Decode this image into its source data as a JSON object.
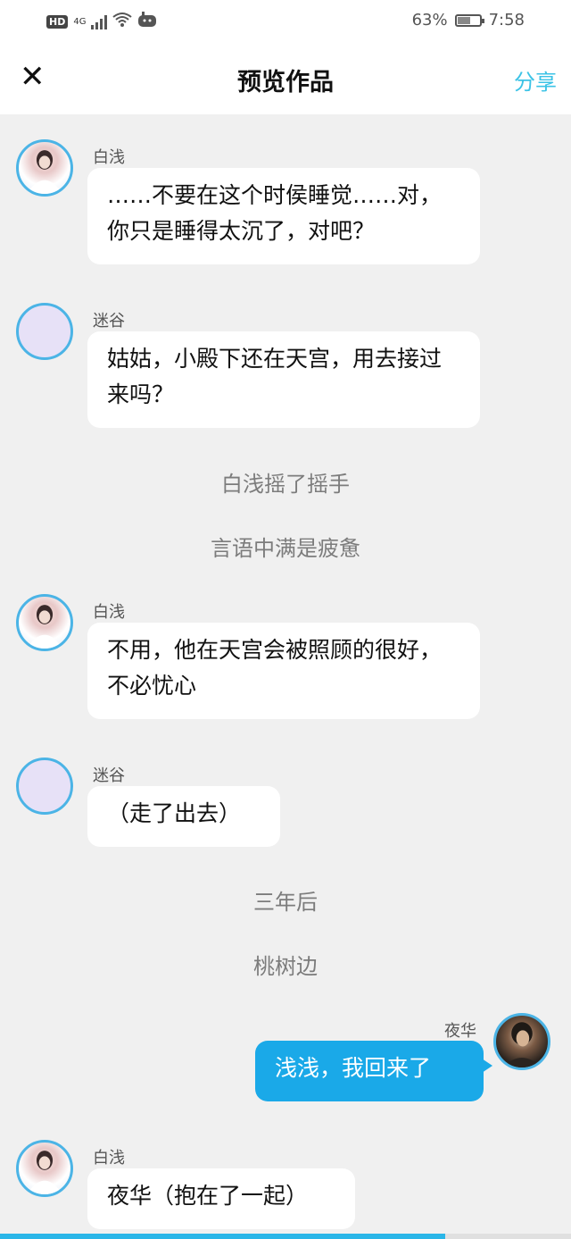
{
  "status_bar": {
    "hd": "HD",
    "network": "4G",
    "battery_percent": "63%",
    "battery_level": 0.63,
    "time": "7:58"
  },
  "header": {
    "close_icon": "✕",
    "title": "预览作品",
    "share_label": "分享"
  },
  "messages": [
    {
      "speaker": "白浅",
      "text": "……不要在这个时侯睡觉……对，你只是睡得太沉了，对吧？"
    },
    {
      "speaker": "迷谷",
      "text": "姑姑，小殿下还在天宫，用去接过来吗？"
    },
    {
      "narration": "白浅摇了摇手"
    },
    {
      "narration": "言语中满是疲惫"
    },
    {
      "speaker": "白浅",
      "text": "不用，他在天宫会被照顾的很好，不必忧心"
    },
    {
      "speaker": "迷谷",
      "text": "（走了出去）"
    },
    {
      "narration": "三年后"
    },
    {
      "narration": "桃树边"
    },
    {
      "speaker": "夜华",
      "text": "浅浅，我回来了",
      "side": "right"
    },
    {
      "speaker": "白浅",
      "text": "夜华（抱在了一起）"
    }
  ],
  "progress": 0.78,
  "colors": {
    "accent": "#3cc3e6",
    "my_bubble": "#1aa9e8",
    "avatar_border": "#4bb4e6",
    "background": "#f0f0f0"
  }
}
